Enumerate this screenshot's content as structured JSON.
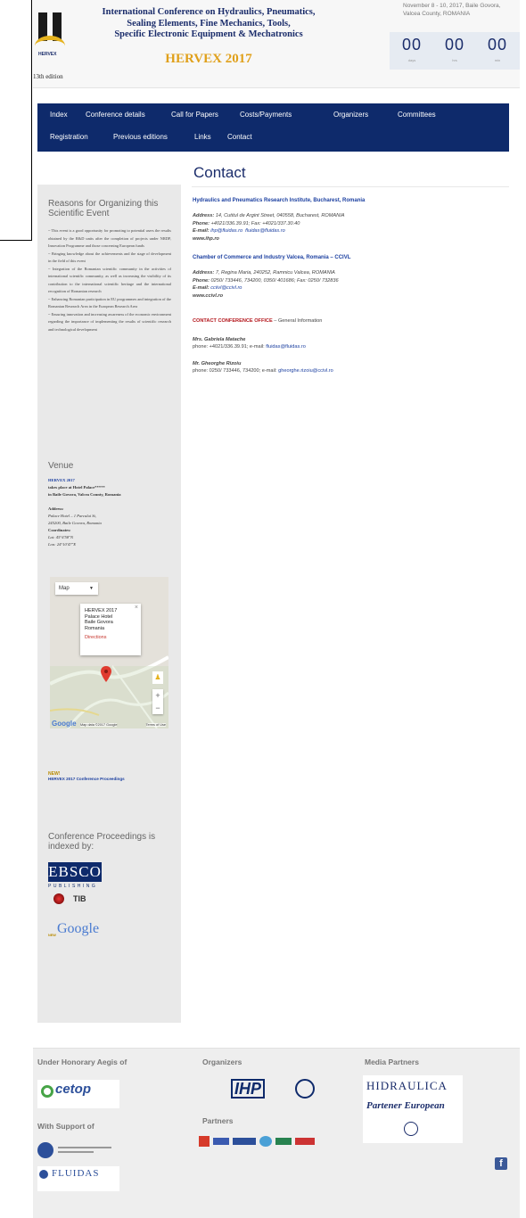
{
  "header": {
    "logo_edition": "13th edition",
    "logo_name": "HERVEX",
    "title_lines": [
      "International Conference on Hydraulics, Pneumatics,",
      "Sealing Elements, Fine Mechanics, Tools,",
      "Specific Electronic Equipment & Mechatronics"
    ],
    "subtitle": "HERVEX 2017",
    "dates": "November 8 - 10, 2017, Baile Govora, Valcea County, ROMANIA",
    "countdown": [
      {
        "value": "00",
        "label": "days"
      },
      {
        "value": "00",
        "label": "hrs"
      },
      {
        "value": "00",
        "label": "min"
      }
    ]
  },
  "nav": {
    "row1": [
      "Index",
      "Conference details",
      "Call for Papers",
      "Costs/Payments",
      "Organizers",
      "Committees"
    ],
    "row2": [
      "Registration",
      "Previous editions",
      "Links",
      "Contact"
    ]
  },
  "sidebar": {
    "reasons_title": "Reasons for Organizing this Scientific Event",
    "reasons": [
      "~ This event is a good opportunity for promoting to potential users the results obtained by the R&D units after the completion of projects under NRDP, Innovation Programme and those concerning European funds",
      "~ Bringing knowledge about the achievements and the stage of development in the field of this event",
      "~ Integration of the Romanian scientific community in the activities of international scientific community, as well as increasing the visibility of its contribution to the international scientific heritage and the international recognition of Romanian research",
      "~ Enhancing Romanian participation in EU programmes and integration of the Romanian Research Area in the European Research Area",
      "~ Ensuring innovation and increasing awareness of the economic environment regarding the importance of implementing the results of scientific research and technological development"
    ],
    "venue_title": "Venue",
    "venue_event": "HERVEX 2017",
    "venue_place": "takes place at Hotel Palace*****",
    "venue_location": "in Baile Govora, Valcea County, Romania",
    "address_label": "Address:",
    "address_lines": [
      "Palace Hotel – 1 Parcului St,",
      "245200, Baile Govora, Romania"
    ],
    "coordinates_label": "Coordinates:",
    "lat": "Lat: 45°4'58\"N",
    "lon": "Lon: 24°10'47\"E",
    "map": {
      "dropdown": "Map",
      "popup_title": "HERVEX 2017",
      "popup_lines": [
        "Palace Hotel",
        "Baile Govora",
        "Romania"
      ],
      "popup_link": "Directions",
      "attribution": "Map data ©2017 Google",
      "terms": "Terms of Use",
      "google": "Google"
    },
    "news_label": "NEW!",
    "news_link": "HERVEX 2017 Conference Proceedings",
    "indexed_title": "Conference Proceedings is indexed by:",
    "ebsco": "EBSCO",
    "ebsco_sub": "PUBLISHING",
    "google_new": "NEW",
    "google": "Google"
  },
  "content": {
    "title": "Contact",
    "org1_name": "Hydraulics and Pneumatics Research Institute, Bucharest, Romania",
    "org1_address_label": "Address:",
    "org1_address": "14, Cutitul de Argint Street, 040558, Bucharest, ROMANIA",
    "org1_phone_label": "Phone:",
    "org1_phone": "+4021/336.39.91; Fax: +4021/337.30.40",
    "org1_email_label": "E-mail:",
    "org1_emails": [
      "ihp@fluidas.ro",
      "fluidas@fluidas.ro"
    ],
    "org1_web": "www.ihp.ro",
    "org2_name": "Chamber of Commerce and Industry Valcea, Romania – CCIVL",
    "org2_address_label": "Address:",
    "org2_address": "7, Regina Maria, 240252, Ramnicu Valcea, ROMANIA",
    "org2_phone_label": "Phone:",
    "org2_phone": "0250/ 733446, 734200, 0350/ 401686; Fax: 0250/ 732836",
    "org2_email_label": "E-mail:",
    "org2_email": "cciivl@ccivl.ro",
    "org2_web": "www.ccivl.ro",
    "office_title": "CONTACT CONFERENCE OFFICE",
    "office_sub": "– General Information",
    "person1_name": "Mrs. Gabriela Matache",
    "person1_phone": "phone: +4021/336.39.91; e-mail:",
    "person1_email": "fluidas@fluidas.ro",
    "person2_name": "Mr. Gheorghe Rizoiu",
    "person2_phone": "phone: 0250/ 733446, 734200; e-mail:",
    "person2_email": "gheorghe.rizoiu@ccivl.ro"
  },
  "footer": {
    "honorary_title": "Under Honorary Aegis of",
    "cetop": "cetop",
    "support_title": "With Support of",
    "fluidas": "FLUIDAS",
    "organizers_title": "Organizers",
    "ihp": "IHP",
    "partners_title": "Partners",
    "media_title": "Media Partners",
    "hidraulica": "HIDRAULICA",
    "partener": "Partener European"
  }
}
